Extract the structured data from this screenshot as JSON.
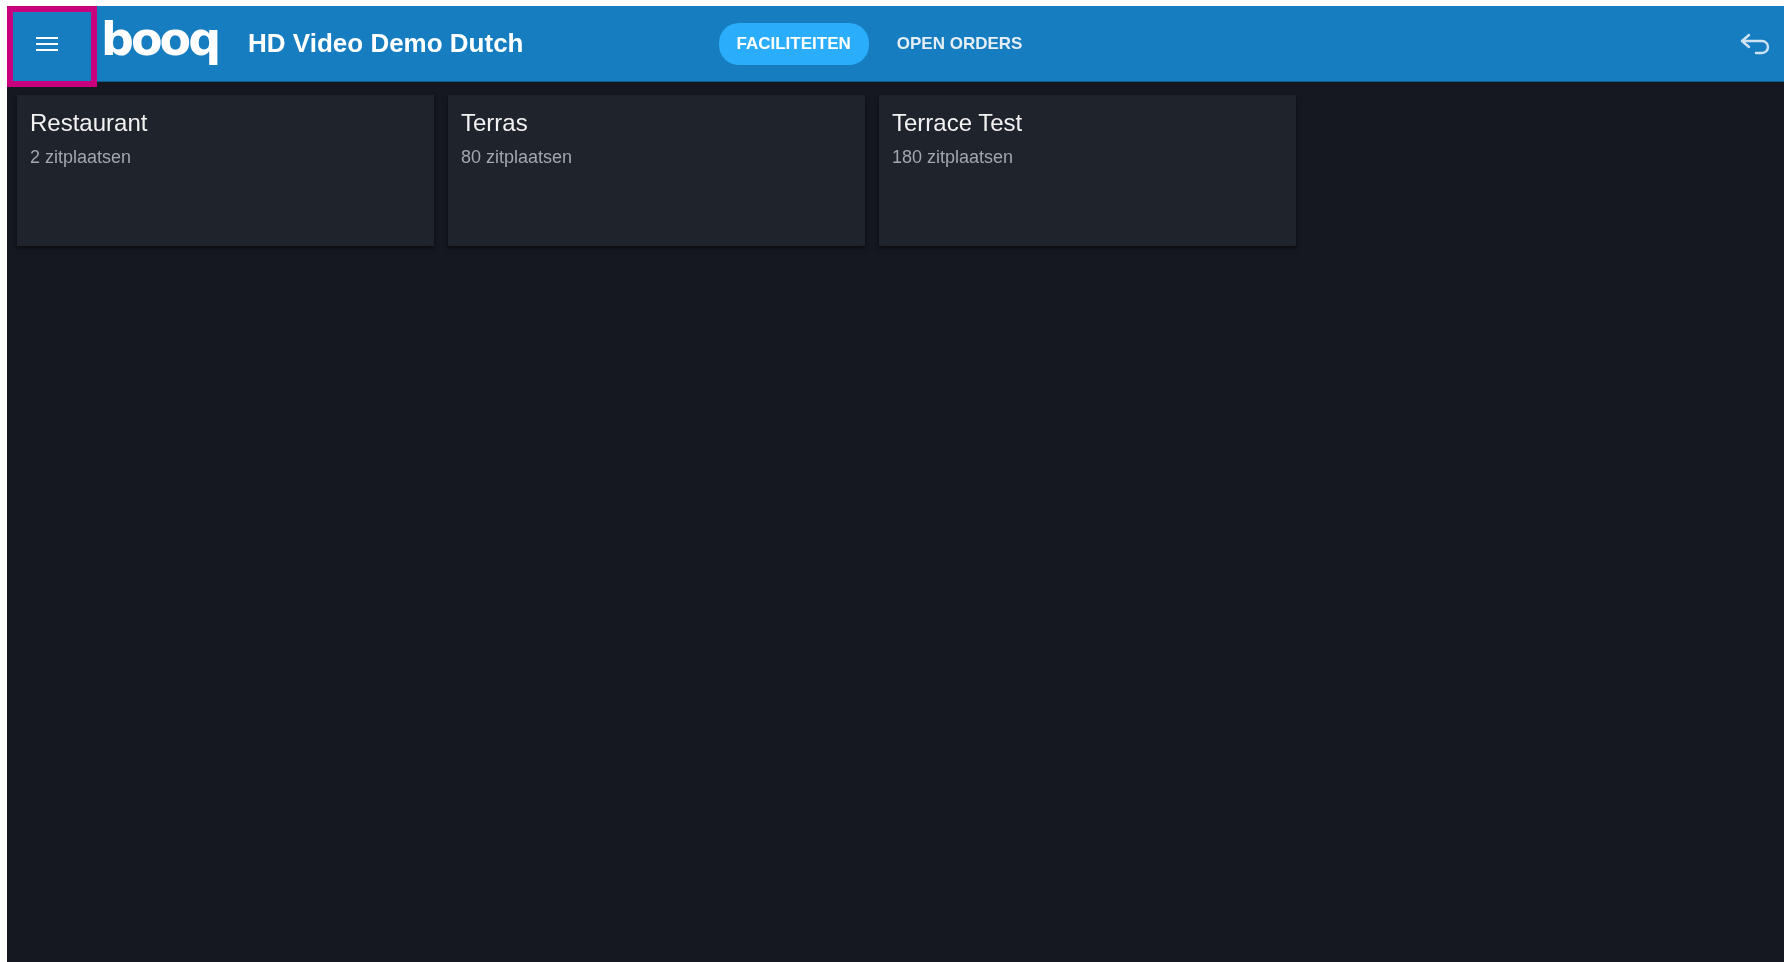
{
  "header": {
    "logo": "booq",
    "title": "HD Video Demo Dutch",
    "tabs": [
      {
        "label": "FACILITEITEN",
        "selected": true
      },
      {
        "label": "OPEN ORDERS",
        "selected": false
      }
    ]
  },
  "menu_button": {
    "highlighted": true
  },
  "facilities": [
    {
      "name": "Restaurant",
      "seats": "2 zitplaatsen"
    },
    {
      "name": "Terras",
      "seats": "80 zitplaatsen"
    },
    {
      "name": "Terrace Test",
      "seats": "180 zitplaatsen"
    }
  ]
}
